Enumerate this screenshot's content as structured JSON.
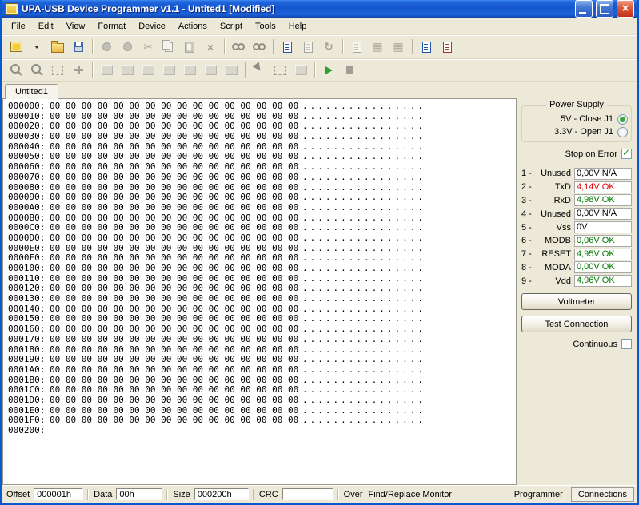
{
  "window": {
    "title": "UPA-USB Device Programmer v1.1  - Untited1 [Modified]"
  },
  "menu": {
    "items": [
      "File",
      "Edit",
      "View",
      "Format",
      "Device",
      "Actions",
      "Script",
      "Tools",
      "Help"
    ]
  },
  "toolbar_main": {
    "icons": [
      {
        "name": "programmer-chip-icon",
        "enabled": true
      },
      {
        "name": "chip-dropdown-icon",
        "enabled": true
      },
      {
        "name": "open-file-icon",
        "enabled": true
      },
      {
        "name": "save-icon",
        "enabled": true
      },
      {
        "name": "separator"
      },
      {
        "name": "read-device-icon",
        "enabled": false
      },
      {
        "name": "write-device-icon",
        "enabled": false
      },
      {
        "name": "cut-icon",
        "enabled": false
      },
      {
        "name": "copy-icon",
        "enabled": false
      },
      {
        "name": "paste-icon",
        "enabled": false
      },
      {
        "name": "delete-icon",
        "enabled": false
      },
      {
        "name": "separator"
      },
      {
        "name": "find-icon",
        "enabled": false
      },
      {
        "name": "find-next-icon",
        "enabled": false
      },
      {
        "name": "separator"
      },
      {
        "name": "script-editor-icon",
        "enabled": true
      },
      {
        "name": "new-window-icon",
        "enabled": false
      },
      {
        "name": "refresh-icon",
        "enabled": false
      },
      {
        "name": "separator"
      },
      {
        "name": "compare-icon",
        "enabled": false
      },
      {
        "name": "checksum-icon",
        "enabled": false
      },
      {
        "name": "fill-buffer-icon",
        "enabled": false
      },
      {
        "name": "separator"
      },
      {
        "name": "device-info-icon",
        "enabled": true
      },
      {
        "name": "options-icon",
        "enabled": true
      }
    ]
  },
  "toolbar_secondary": {
    "icons": [
      {
        "name": "zoom-in-icon",
        "enabled": false
      },
      {
        "name": "zoom-out-icon",
        "enabled": false
      },
      {
        "name": "select-block-icon",
        "enabled": false
      },
      {
        "name": "goto-address-icon",
        "enabled": false
      },
      {
        "name": "separator"
      },
      {
        "name": "buffer-1-icon",
        "enabled": false
      },
      {
        "name": "buffer-2-icon",
        "enabled": false
      },
      {
        "name": "buffer-3-icon",
        "enabled": false
      },
      {
        "name": "buffer-4-icon",
        "enabled": false
      },
      {
        "name": "buffer-5-icon",
        "enabled": false
      },
      {
        "name": "buffer-6-icon",
        "enabled": false
      },
      {
        "name": "buffer-7-icon",
        "enabled": false
      },
      {
        "name": "separator"
      },
      {
        "name": "pointer-icon",
        "enabled": false
      },
      {
        "name": "select-range-icon",
        "enabled": false
      },
      {
        "name": "edit-mode-icon",
        "enabled": false
      },
      {
        "name": "separator"
      },
      {
        "name": "run-script-icon",
        "enabled": true
      },
      {
        "name": "stop-script-icon",
        "enabled": false
      }
    ]
  },
  "document_tab": {
    "label": "Untited1"
  },
  "hex": {
    "addresses": [
      "000000:",
      "000010:",
      "000020:",
      "000030:",
      "000040:",
      "000050:",
      "000060:",
      "000070:",
      "000080:",
      "000090:",
      "0000A0:",
      "0000B0:",
      "0000C0:",
      "0000D0:",
      "0000E0:",
      "0000F0:",
      "000100:",
      "000110:",
      "000120:",
      "000130:",
      "000140:",
      "000150:",
      "000160:",
      "000170:",
      "000180:",
      "000190:",
      "0001A0:",
      "0001B0:",
      "0001C0:",
      "0001D0:",
      "0001E0:",
      "0001F0:",
      "000200:"
    ],
    "row_bytes": "00 00 00 00 00 00 00 00 00 00 00 00 00 00 00 00",
    "row_ascii": "................",
    "last_row_empty": true
  },
  "side_panel": {
    "power_supply": {
      "title": "Power Supply",
      "options": [
        {
          "label": "5V - Close J1",
          "selected": true
        },
        {
          "label": "3.3V - Open J1",
          "selected": false
        }
      ]
    },
    "stop_on_error": {
      "label": "Stop on Error",
      "checked": true
    },
    "pins": [
      {
        "num": "1 -",
        "name": "Unused",
        "value": "0,00V N/A",
        "color": "black"
      },
      {
        "num": "2 -",
        "name": "TxD",
        "value": "4,14V OK",
        "color": "red"
      },
      {
        "num": "3 -",
        "name": "RxD",
        "value": "4,98V OK",
        "color": "green"
      },
      {
        "num": "4 -",
        "name": "Unused",
        "value": "0,00V N/A",
        "color": "black"
      },
      {
        "num": "5 -",
        "name": "Vss",
        "value": "0V",
        "color": "black"
      },
      {
        "num": "6 -",
        "name": "MODB",
        "value": "0,06V OK",
        "color": "green"
      },
      {
        "num": "7 -",
        "name": "RESET",
        "value": "4,95V OK",
        "color": "green"
      },
      {
        "num": "8 -",
        "name": "MODA",
        "value": "0,00V OK",
        "color": "green"
      },
      {
        "num": "9 -",
        "name": "Vdd",
        "value": "4,96V OK",
        "color": "green"
      }
    ],
    "voltmeter_button": "Voltmeter",
    "test_connection_button": "Test Connection",
    "continuous": {
      "label": "Continuous",
      "checked": false
    }
  },
  "status_bar": {
    "offset_label": "Offset",
    "offset_value": "000001h",
    "data_label": "Data",
    "data_value": "00h",
    "size_label": "Size",
    "size_value": "000200h",
    "crc_label": "CRC",
    "crc_value": "",
    "over_label": "Over",
    "find_replace_label": "Find/Replace Monitor",
    "tabs": [
      {
        "label": "Programmer",
        "active": false
      },
      {
        "label": "Connections",
        "active": true
      }
    ]
  },
  "colors": {
    "titlebar_blue": "#1356CE",
    "client_bg": "#ECE9D8",
    "ok_green": "#007B00",
    "warn_red": "#E00000"
  }
}
